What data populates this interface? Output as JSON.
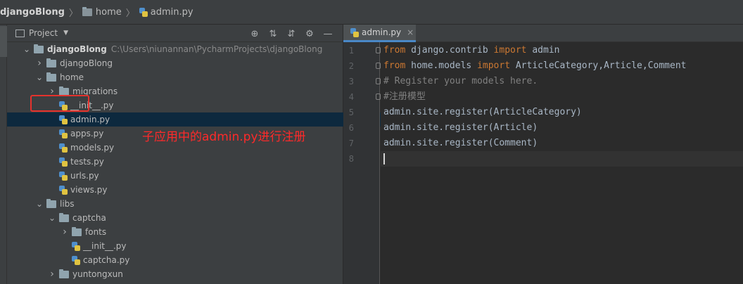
{
  "breadcrumb": {
    "items": [
      "djangoBlong",
      "home",
      "admin.py"
    ]
  },
  "project_panel": {
    "title": "Project",
    "tools": [
      "locate-icon",
      "expand-all-icon",
      "collapse-all-icon",
      "gear-icon",
      "minimize-icon"
    ],
    "tree": [
      {
        "label": "djangoBlong",
        "path": "C:\\Users\\niunannan\\PycharmProjects\\djangoBlong",
        "type": "folder",
        "depth": 0,
        "expanded": true,
        "bold": true
      },
      {
        "label": "djangoBlong",
        "type": "folder",
        "depth": 1,
        "expanded": false
      },
      {
        "label": "home",
        "type": "folder",
        "depth": 1,
        "expanded": true
      },
      {
        "label": "migrations",
        "type": "folder",
        "depth": 2,
        "expanded": false
      },
      {
        "label": "__init__.py",
        "type": "py",
        "depth": 2
      },
      {
        "label": "admin.py",
        "type": "py",
        "depth": 2,
        "selected": true
      },
      {
        "label": "apps.py",
        "type": "py",
        "depth": 2
      },
      {
        "label": "models.py",
        "type": "py",
        "depth": 2
      },
      {
        "label": "tests.py",
        "type": "py",
        "depth": 2
      },
      {
        "label": "urls.py",
        "type": "py",
        "depth": 2
      },
      {
        "label": "views.py",
        "type": "py",
        "depth": 2
      },
      {
        "label": "libs",
        "type": "folder",
        "depth": 1,
        "expanded": true
      },
      {
        "label": "captcha",
        "type": "folder",
        "depth": 2,
        "expanded": true
      },
      {
        "label": "fonts",
        "type": "folder",
        "depth": 3,
        "expanded": false
      },
      {
        "label": "__init__.py",
        "type": "py",
        "depth": 3
      },
      {
        "label": "captcha.py",
        "type": "py",
        "depth": 3
      },
      {
        "label": "yuntongxun",
        "type": "folder",
        "depth": 2,
        "expanded": false
      }
    ]
  },
  "annotation": "子应用中的admin.py进行注册",
  "editor": {
    "tab_label": "admin.py",
    "tab_close": "×",
    "line_numbers": [
      "1",
      "2",
      "3",
      "4",
      "5",
      "6",
      "7",
      "8"
    ],
    "lines": [
      [
        {
          "t": "from",
          "c": "kw"
        },
        {
          "t": " django.contrib ",
          "c": ""
        },
        {
          "t": "import",
          "c": "kw"
        },
        {
          "t": " admin",
          "c": ""
        }
      ],
      [
        {
          "t": "from",
          "c": "kw"
        },
        {
          "t": " home.models ",
          "c": ""
        },
        {
          "t": "import",
          "c": "kw"
        },
        {
          "t": " ArticleCategory,Article,Comment",
          "c": ""
        }
      ],
      [
        {
          "t": "# Register your models here.",
          "c": "cm"
        }
      ],
      [
        {
          "t": "#注册模型",
          "c": "cm"
        }
      ],
      [
        {
          "t": "admin.site.register(ArticleCategory)",
          "c": ""
        }
      ],
      [
        {
          "t": "admin.site.register(Article)",
          "c": ""
        }
      ],
      [
        {
          "t": "admin.site.register(Comment)",
          "c": ""
        }
      ],
      []
    ],
    "current_line": 8
  },
  "colors": {
    "keyword": "#cc7832",
    "comment": "#808080",
    "text": "#a9b7c6",
    "annotation": "#ff2a2a",
    "selection": "#0d293e"
  }
}
